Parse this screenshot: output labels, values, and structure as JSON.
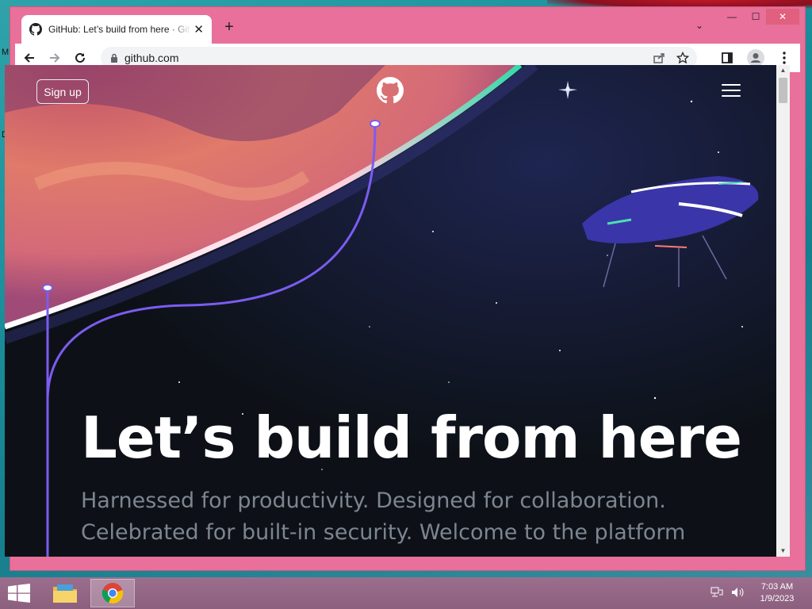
{
  "desktop": {
    "edge_letters": [
      "M",
      "D"
    ]
  },
  "browser": {
    "tab": {
      "title": "GitHub: Let’s build from here · GitHub",
      "favicon": "github-icon"
    },
    "new_tab_label": "+",
    "address": {
      "url": "github.com"
    },
    "window_controls": {
      "minimize": "—",
      "maximize": "☐",
      "close": "✕"
    }
  },
  "page": {
    "signup_label": "Sign up",
    "headline": "Let’s build from here",
    "subhead": "Harnessed for productivity. Designed for collaboration. Celebrated for built-in security. Welcome to the platform"
  },
  "taskbar": {
    "time": "7:03 AM",
    "date": "1/9/2023",
    "apps": [
      "file-explorer-icon",
      "chrome-icon"
    ]
  },
  "colors": {
    "window_frame": "#e8709a",
    "page_background": "#0d1117",
    "headline": "#ffffff",
    "subhead": "#7d8590",
    "accent_line": "#7b5cf0"
  }
}
